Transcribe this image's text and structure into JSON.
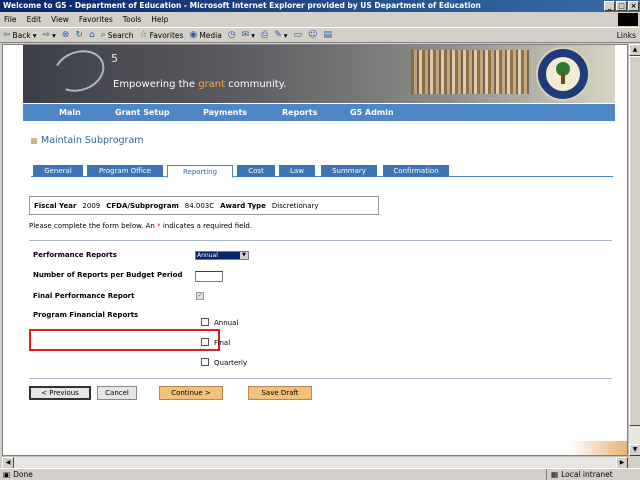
{
  "window": {
    "title": "Welcome to G5 - Department of Education - Microsoft Internet Explorer provided by US Department of Education"
  },
  "menubar": [
    "File",
    "Edit",
    "View",
    "Favorites",
    "Tools",
    "Help"
  ],
  "toolbar": {
    "back": "Back",
    "search": "Search",
    "favorites": "Favorites",
    "media": "Media",
    "links": "Links"
  },
  "banner": {
    "logo_text": "5",
    "tagline_start": "Empowering the ",
    "tagline_highlight": "grant",
    "tagline_end": " community."
  },
  "nav": [
    "Main",
    "Grant Setup",
    "Payments",
    "Reports",
    "G5 Admin"
  ],
  "section_title": "Maintain Subprogram",
  "tabs": [
    "General",
    "Program Office",
    "Reporting",
    "Cost",
    "Law",
    "Summary",
    "Confirmation"
  ],
  "active_tab": "Reporting",
  "info": {
    "fiscal_year_label": "Fiscal Year",
    "fiscal_year": "2009",
    "cfda_label": "CFDA/Subprogram",
    "cfda": "84.003C",
    "award_type_label": "Award Type",
    "award_type": "Discretionary"
  },
  "instructions": {
    "before": "Please complete the form below. An ",
    "asterisk": "*",
    "after": " indicates a required field."
  },
  "form": {
    "performance_reports_label": "Performance Reports",
    "performance_reports_value": "Annual",
    "num_reports_label": "Number of Reports per Budget Period",
    "num_reports_value": "",
    "final_performance_label": "Final Performance Report",
    "final_performance_checked": true,
    "program_financial_label": "Program Financial Reports",
    "financial_options": [
      {
        "label": "Annual",
        "checked": false
      },
      {
        "label": "Final",
        "checked": false
      },
      {
        "label": "Quarterly",
        "checked": false
      }
    ]
  },
  "buttons": {
    "previous": "< Previous",
    "cancel": "Cancel",
    "continue": "Continue >",
    "save_draft": "Save Draft"
  },
  "status": {
    "left": "Done",
    "zone": "Local intranet"
  },
  "colors": {
    "nav_blue": "#4f86c6",
    "title_blue": "#336699",
    "highlight_red": "#e32020",
    "button_orange": "#f3c27a"
  }
}
